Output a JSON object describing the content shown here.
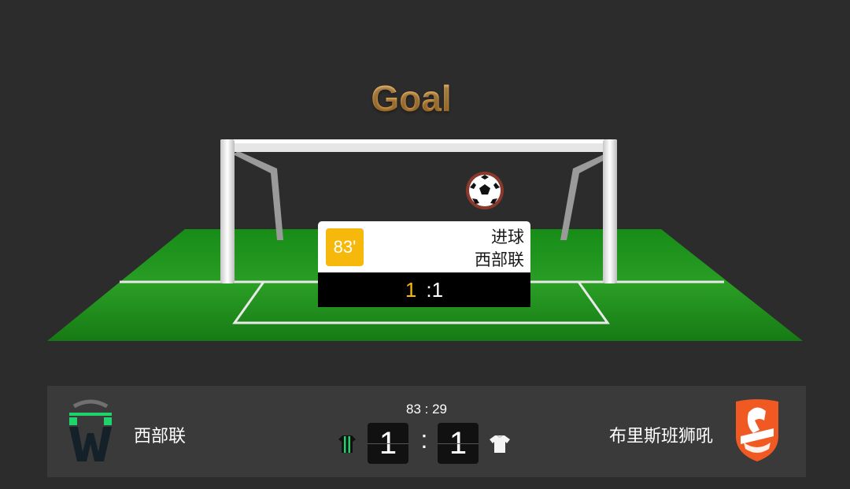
{
  "animation": {
    "title": "Goal",
    "event": {
      "minute": "83'",
      "type": "进球",
      "team": "西部联",
      "score_scorer": "1",
      "score_rest": ":1"
    }
  },
  "scoreboard": {
    "clock": "83 : 29",
    "home": {
      "name": "西部联",
      "score": "1",
      "logo_icon": "western-united-crest-icon",
      "kit_icon": "green-black-jersey-icon"
    },
    "away": {
      "name": "布里斯班狮吼",
      "score": "1",
      "logo_icon": "brisbane-roar-crest-icon",
      "kit_icon": "white-jersey-icon"
    },
    "separator": ":"
  },
  "colors": {
    "background": "#2c2c2c",
    "accent": "#f6b80b",
    "pitch": "#1f8a1f",
    "away_brand": "#f05a22",
    "home_brand": "#1fd36b"
  }
}
